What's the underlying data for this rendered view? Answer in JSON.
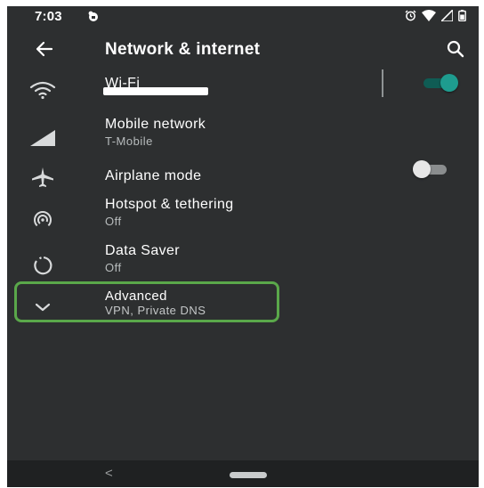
{
  "status_bar": {
    "time": "7:03",
    "left_icon": "notification-badge-icon",
    "right_icons": [
      "alarm-icon",
      "wifi-signal-icon",
      "cell-signal-icon",
      "battery-icon"
    ]
  },
  "app_bar": {
    "title": "Network & internet",
    "back_icon": "back-arrow-icon",
    "search_icon": "search-icon"
  },
  "items": [
    {
      "id": "wifi",
      "title": "Wi-Fi",
      "subtitle": "",
      "icon": "wifi-icon",
      "toggle": "on"
    },
    {
      "id": "mobile",
      "title": "Mobile network",
      "subtitle": "T-Mobile",
      "icon": "cell-signal-icon"
    },
    {
      "id": "airplane",
      "title": "Airplane mode",
      "subtitle": "",
      "icon": "airplane-icon",
      "toggle": "off"
    },
    {
      "id": "hotspot",
      "title": "Hotspot & tethering",
      "subtitle": "Off",
      "icon": "hotspot-icon"
    },
    {
      "id": "datasaver",
      "title": "Data Saver",
      "subtitle": "Off",
      "icon": "data-saver-icon"
    },
    {
      "id": "advanced",
      "title": "Advanced",
      "subtitle": "VPN, Private DNS",
      "icon": "chevron-down-icon"
    }
  ],
  "nav_bar": {
    "back_glyph": "<",
    "home_icon": "home-pill-icon"
  },
  "colors": {
    "background": "#2d2f30",
    "text_primary": "#ffffff",
    "text_secondary": "#b8bcbd",
    "toggle_on_thumb": "#1e9c8f",
    "toggle_on_track": "#0f5c54",
    "toggle_off_thumb": "#e6e6e6",
    "toggle_off_track": "#8a8d8e",
    "highlight": "#5aa84a"
  }
}
